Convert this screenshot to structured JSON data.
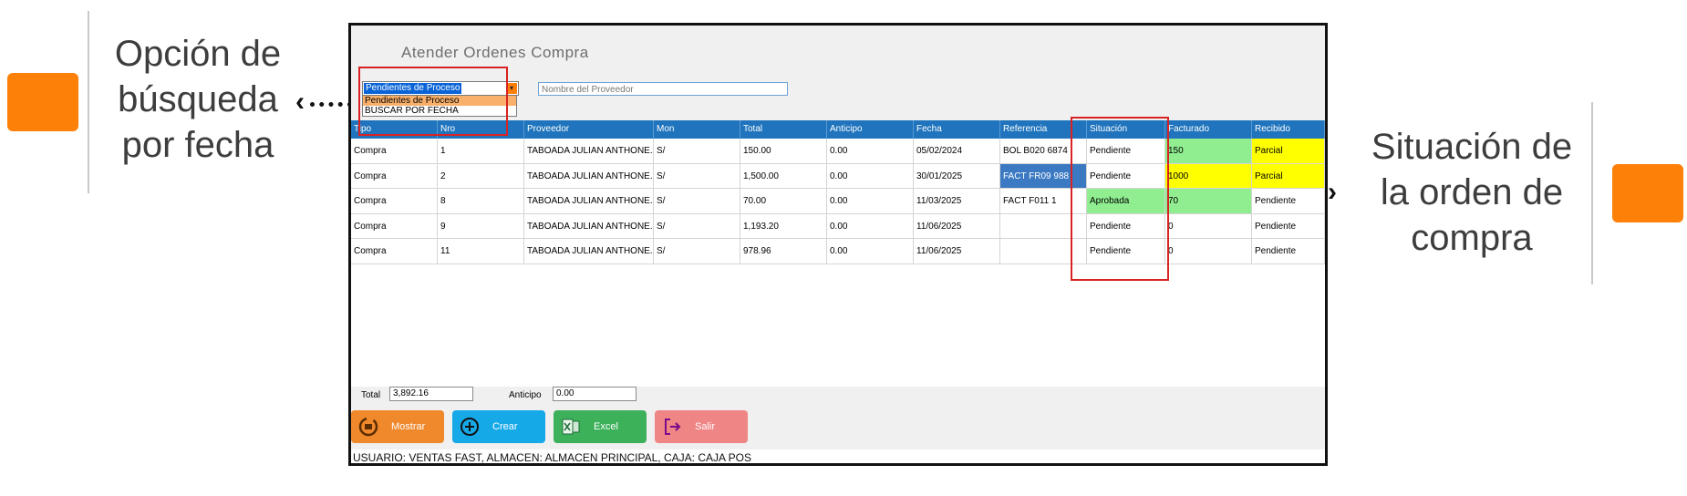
{
  "callouts": {
    "left": {
      "line1": "Opción de",
      "line2": "búsqueda",
      "line3": "por fecha"
    },
    "right": {
      "line1": "Situación de",
      "line2": "la orden de",
      "line3": "compra"
    }
  },
  "window": {
    "title": "Atender Ordenes Compra",
    "filter": {
      "selected": "Pendientes de Proceso",
      "options": [
        "Pendientes de Proceso",
        "BUSCAR POR FECHA"
      ]
    },
    "supplier_search": {
      "placeholder": "Nombre del Proveedor"
    }
  },
  "grid": {
    "columns": [
      "Tipo",
      "Nro",
      "Proveedor",
      "Mon",
      "Total",
      "Anticipo",
      "Fecha",
      "Referencia",
      "Situación",
      "Facturado",
      "Recibido"
    ],
    "rows": [
      {
        "tipo": "Compra",
        "nro": "1",
        "proveedor": "TABOADA JULIAN ANTHONE...",
        "mon": "S/",
        "total": "150.00",
        "anticipo": "0.00",
        "fecha": "05/02/2024",
        "referencia": "BOL B020 6874",
        "situacion": "Pendiente",
        "facturado": "150",
        "recibido": "Parcial"
      },
      {
        "tipo": "Compra",
        "nro": "2",
        "proveedor": "TABOADA JULIAN ANTHONE...",
        "mon": "S/",
        "total": "1,500.00",
        "anticipo": "0.00",
        "fecha": "30/01/2025",
        "referencia": "FACT FR09 988",
        "situacion": "Pendiente",
        "facturado": "1000",
        "recibido": "Parcial"
      },
      {
        "tipo": "Compra",
        "nro": "8",
        "proveedor": "TABOADA JULIAN ANTHONE...",
        "mon": "S/",
        "total": "70.00",
        "anticipo": "0.00",
        "fecha": "11/03/2025",
        "referencia": "FACT F011 1",
        "situacion": "Aprobada",
        "facturado": "70",
        "recibido": "Pendiente"
      },
      {
        "tipo": "Compra",
        "nro": "9",
        "proveedor": "TABOADA JULIAN ANTHONE...",
        "mon": "S/",
        "total": "1,193.20",
        "anticipo": "0.00",
        "fecha": "11/06/2025",
        "referencia": "",
        "situacion": "Pendiente",
        "facturado": "0",
        "recibido": "Pendiente"
      },
      {
        "tipo": "Compra",
        "nro": "11",
        "proveedor": "TABOADA JULIAN ANTHONE...",
        "mon": "S/",
        "total": "978.96",
        "anticipo": "0.00",
        "fecha": "11/06/2025",
        "referencia": "",
        "situacion": "Pendiente",
        "facturado": "0",
        "recibido": "Pendiente"
      }
    ]
  },
  "totals": {
    "total_label": "Total",
    "total_value": "3,892.16",
    "anticipo_label": "Anticipo",
    "anticipo_value": "0.00"
  },
  "buttons": {
    "mostrar": "Mostrar",
    "crear": "Crear",
    "excel": "Excel",
    "salir": "Salir"
  },
  "status_bar": "USUARIO: VENTAS FAST, ALMACEN: ALMACEN PRINCIPAL, CAJA: CAJA POS",
  "colors": {
    "accent_orange": "#fd8008",
    "header_blue": "#1f74bd",
    "highlight_green": "#90ee90",
    "highlight_yellow": "#ffff00",
    "btn_mostrar": "#f0882c",
    "btn_crear": "#16a9e8",
    "btn_excel": "#3cb15a",
    "btn_salir": "#ef8585"
  }
}
